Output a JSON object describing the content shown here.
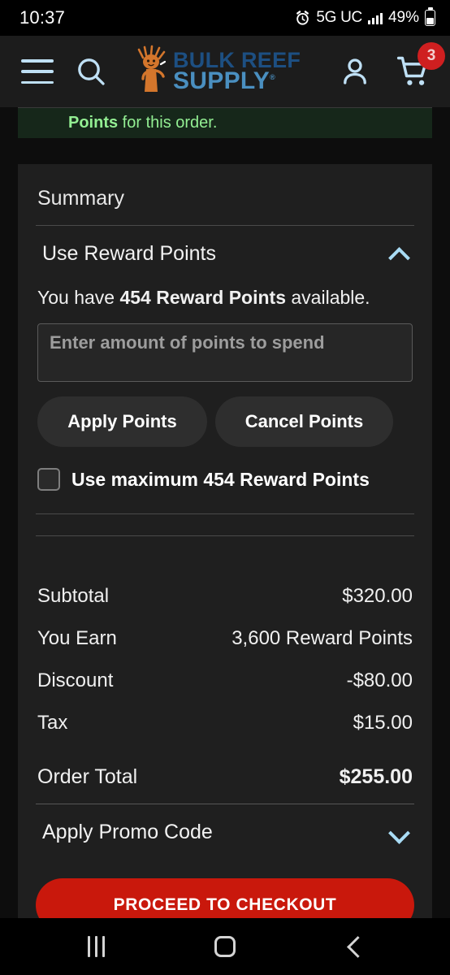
{
  "status_bar": {
    "time": "10:37",
    "network": "5G UC",
    "battery_percent": "49%",
    "alarm_icon": "alarm-clock-icon",
    "signal_icon": "signal-bars-icon",
    "battery_icon": "battery-icon"
  },
  "header": {
    "menu_icon": "hamburger-menu-icon",
    "search_icon": "search-icon",
    "account_icon": "account-person-icon",
    "cart_icon": "shopping-cart-icon",
    "cart_count": "3",
    "logo": {
      "line1": "BULK REEF",
      "line2": "SUPPLY",
      "registered_mark": "®",
      "mascot_icon": "coral-mascot-icon",
      "line1_color": "#1d4f82",
      "line2_color": "#4a8fc0"
    }
  },
  "notice": {
    "bold_text": "Points",
    "rest_text": " for this order.",
    "background_color": "#16271a",
    "text_color": "#93ef93"
  },
  "summary": {
    "title": "Summary",
    "reward_section": {
      "label": "Use Reward Points",
      "chevron_icon": "chevron-up-icon",
      "expanded": true,
      "available_prefix": "You have ",
      "available_bold": "454 Reward Points",
      "available_suffix": " available.",
      "input_placeholder": "Enter amount of points to spend",
      "input_value": "",
      "apply_label": "Apply Points",
      "cancel_label": "Cancel Points",
      "max_checkbox_label": "Use maximum 454 Reward Points",
      "max_checkbox_checked": false
    },
    "totals": [
      {
        "label": "Subtotal",
        "value": "$320.00"
      },
      {
        "label": "You Earn",
        "value": "3,600 Reward Points"
      },
      {
        "label": "Discount",
        "value": "-$80.00"
      },
      {
        "label": "Tax",
        "value": "$15.00"
      }
    ],
    "grand_total": {
      "label": "Order Total",
      "value": "$255.00"
    },
    "promo_section": {
      "label": "Apply Promo Code",
      "chevron_icon": "chevron-down-icon",
      "expanded": false
    },
    "checkout_label": "PROCEED TO CHECKOUT",
    "checkout_color": "#c9180c"
  },
  "nav_bar": {
    "recent_icon": "recent-apps-icon",
    "home_icon": "home-icon",
    "back_icon": "back-icon"
  }
}
